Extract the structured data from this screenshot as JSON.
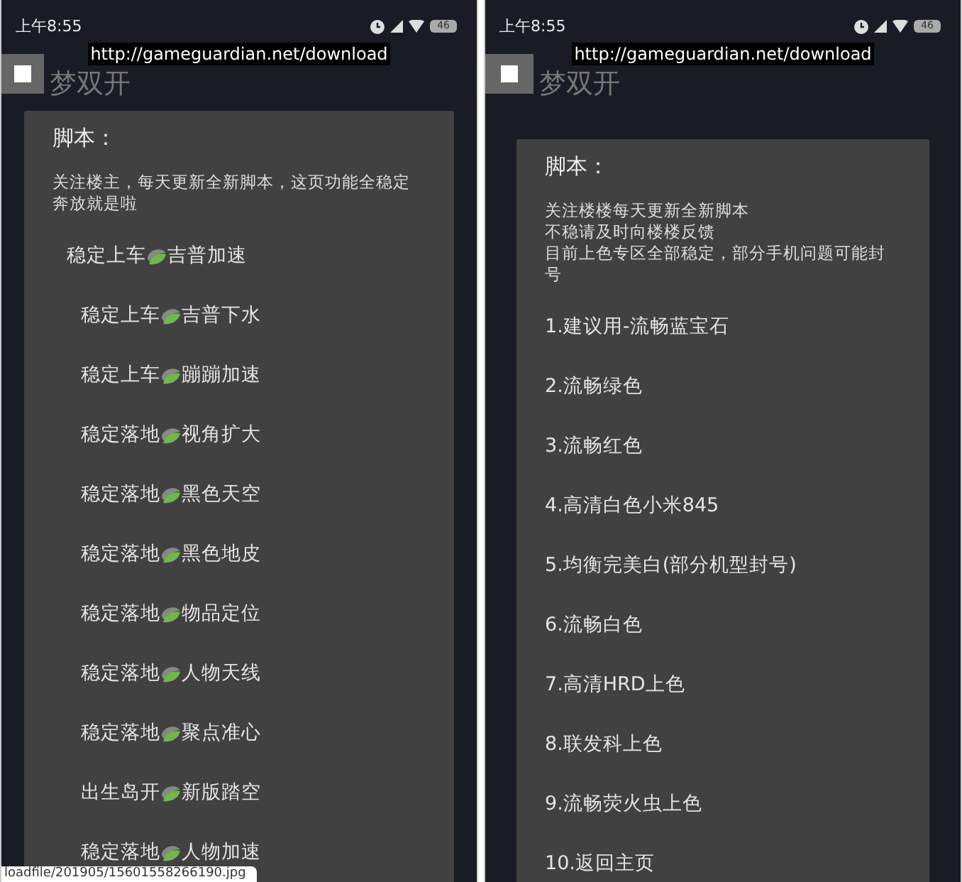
{
  "phones": [
    {
      "status_time": "上午8:55",
      "battery": "46",
      "url": "http://gameguardian.net/download",
      "app_title": "梦双开",
      "dialog": {
        "title": "脚本：",
        "message": [
          "关注楼主，每天更新全新脚本，这页功能全稳定奔放就是啦"
        ],
        "items": [
          {
            "kind": "leaf",
            "prefix": "稳定上车",
            "suffix": "吉普加速"
          },
          {
            "kind": "leaf",
            "prefix": "稳定上车",
            "suffix": "吉普下水"
          },
          {
            "kind": "leaf",
            "prefix": "稳定上车",
            "suffix": "蹦蹦加速"
          },
          {
            "kind": "leaf",
            "prefix": "稳定落地",
            "suffix": "视角扩大"
          },
          {
            "kind": "leaf",
            "prefix": "稳定落地",
            "suffix": "黑色天空"
          },
          {
            "kind": "leaf",
            "prefix": "稳定落地",
            "suffix": "黑色地皮"
          },
          {
            "kind": "leaf",
            "prefix": "稳定落地",
            "suffix": "物品定位"
          },
          {
            "kind": "leaf",
            "prefix": "稳定落地",
            "suffix": "人物天线"
          },
          {
            "kind": "leaf",
            "prefix": "稳定落地",
            "suffix": "聚点准心"
          },
          {
            "kind": "leaf",
            "prefix": "出生岛开",
            "suffix": "新版踏空"
          },
          {
            "kind": "leaf",
            "prefix": "稳定落地",
            "suffix": "人物加速"
          }
        ]
      },
      "link_status": "loadfile/201905/15601558266190.jpg"
    },
    {
      "status_time": "上午8:55",
      "battery": "46",
      "url": "http://gameguardian.net/download",
      "app_title": "梦双开",
      "dialog": {
        "title": "脚本：",
        "message": [
          "关注楼楼每天更新全新脚本",
          "不稳请及时向楼楼反馈",
          "目前上色专区全部稳定，部分手机问题可能封号"
        ],
        "items": [
          {
            "kind": "plain",
            "label": "1.建议用-流畅蓝宝石"
          },
          {
            "kind": "plain",
            "label": "2.流畅绿色"
          },
          {
            "kind": "plain",
            "label": "3.流畅红色"
          },
          {
            "kind": "plain",
            "label": "4.高清白色小米845"
          },
          {
            "kind": "plain",
            "label": "5.均衡完美白(部分机型封号)"
          },
          {
            "kind": "plain",
            "label": "6.流畅白色"
          },
          {
            "kind": "plain",
            "label": "7.高清HRD上色"
          },
          {
            "kind": "plain",
            "label": "8.联发科上色"
          },
          {
            "kind": "plain",
            "label": "9.流畅荧火虫上色"
          },
          {
            "kind": "plain",
            "label": "10.返回主页"
          }
        ]
      }
    }
  ]
}
